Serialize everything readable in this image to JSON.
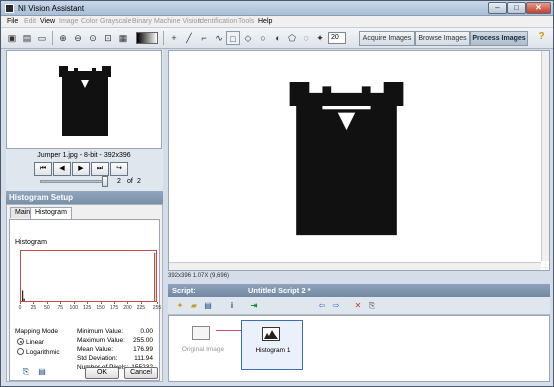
{
  "window": {
    "title": "NI Vision Assistant",
    "controls": {
      "minimize": "–",
      "maximize": "□",
      "close": "✕"
    }
  },
  "menu": [
    {
      "label": "File",
      "enabled": true
    },
    {
      "label": "Edit",
      "enabled": false
    },
    {
      "label": "View",
      "enabled": true
    },
    {
      "label": "Image",
      "enabled": false
    },
    {
      "label": "Color",
      "enabled": false
    },
    {
      "label": "Grayscale",
      "enabled": false
    },
    {
      "label": "Binary",
      "enabled": false
    },
    {
      "label": "Machine Vision",
      "enabled": false
    },
    {
      "label": "Identification",
      "enabled": false
    },
    {
      "label": "Tools",
      "enabled": false
    },
    {
      "label": "Help",
      "enabled": true
    }
  ],
  "toolbar": {
    "tolerance_value": "20",
    "modes": [
      "Acquire Images",
      "Browse Images",
      "Process Images"
    ],
    "active_mode": "Process Images",
    "help_glyph": "?"
  },
  "browser": {
    "caption": "Jumper 1.jpg - 8-bit - 392x396",
    "current_page": "2",
    "of_label": "of",
    "total_pages": "2",
    "nav_glyphs": [
      "⏮",
      "◀",
      "▶",
      "⏭",
      "↪"
    ]
  },
  "setup": {
    "header": "Histogram Setup",
    "tabs": [
      "Main",
      "Histogram"
    ],
    "active_tab": "Histogram",
    "histogram_label": "Histogram",
    "ticks": [
      "0",
      "25",
      "50",
      "75",
      "100",
      "125",
      "150",
      "175",
      "200",
      "225",
      "255"
    ],
    "mapping_mode_label": "Mapping Mode",
    "mapping_options": [
      "Linear",
      "Logarithmic"
    ],
    "mapping_selected": "Linear",
    "stats": [
      {
        "label": "Minimum Value:",
        "value": "0.00"
      },
      {
        "label": "Maximum Value:",
        "value": "255.00"
      },
      {
        "label": "Mean Value:",
        "value": "176.99"
      },
      {
        "label": "Std Deviation:",
        "value": "111.94"
      },
      {
        "label": "Number of Pixels:",
        "value": "155232"
      }
    ],
    "ok_label": "OK",
    "cancel_label": "Cancel"
  },
  "viewer": {
    "status": "392x396 1.07X    (9,696)"
  },
  "script": {
    "header_label": "Script:",
    "name": "Untitled Script 2 *",
    "steps": [
      {
        "label": "Original Image",
        "selected": false,
        "disabled": true
      },
      {
        "label": "Histogram 1",
        "selected": true,
        "disabled": false
      }
    ]
  },
  "colors": {
    "accent": "#7a90aa",
    "histogram_frame": "#c94a4a",
    "step_selection": "#3b6fb5",
    "connector": "#c94a90"
  },
  "chart_data": {
    "type": "bar",
    "title": "",
    "xlabel": "",
    "ylabel": "",
    "xlim": [
      0,
      255
    ],
    "x_ticks": [
      0,
      25,
      50,
      75,
      100,
      125,
      150,
      175,
      200,
      225,
      255
    ],
    "series": [
      {
        "values": [
          {
            "x": 0,
            "y": 0.22
          },
          {
            "x": 3,
            "y": 0.05
          },
          {
            "x": 255,
            "y": 1.0
          }
        ]
      }
    ]
  }
}
